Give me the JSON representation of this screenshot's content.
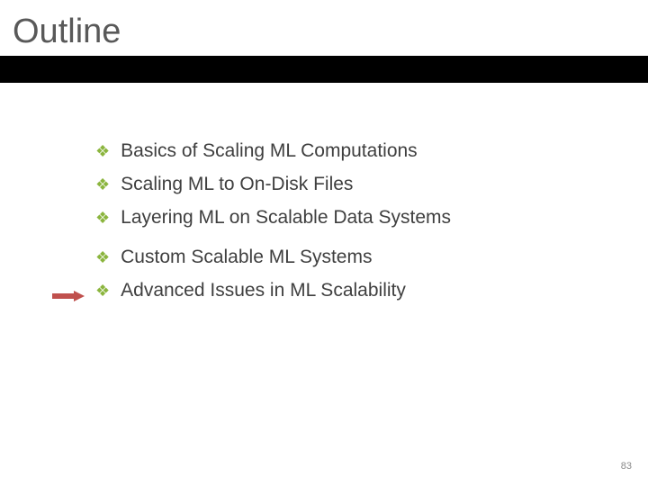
{
  "title": "Outline",
  "items": [
    {
      "label": "Basics of Scaling ML Computations"
    },
    {
      "label": "Scaling ML to On-Disk Files"
    },
    {
      "label": "Layering ML on Scalable Data Systems"
    },
    {
      "label": "Custom Scalable ML Systems"
    },
    {
      "label": "Advanced Issues in ML Scalability"
    }
  ],
  "bullet_glyph": "❖",
  "page_number": "83",
  "arrow_points_to_index": 4
}
